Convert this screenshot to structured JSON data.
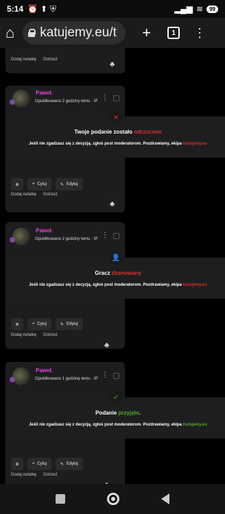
{
  "status": {
    "time": "5:14",
    "battery": "99"
  },
  "browser": {
    "url": "katujemy.eu/t",
    "tabs": "1"
  },
  "labels": {
    "add_note": "Dodaj notatkę",
    "warn": "Ostrzeż",
    "quote": "Cytuj",
    "edit": "Edytuj"
  },
  "posts": [
    {
      "author": "Paweł.",
      "published": "Opublikowano 2 godziny temu · IP",
      "notice_prefix": "Twoje podanie zostało ",
      "notice_status": "odrzucone",
      "notice_body": "Jeśli nie zgadzasz się z decyzją, zgłoś post moderatorom. Pozdrawiamy, ekipa ",
      "notice_brand": "Katujemy.eu",
      "color": "#d9302c"
    },
    {
      "author": "Paweł.",
      "published": "Opublikowano 2 godziny temu · IP",
      "notice_prefix": "Gracz ",
      "notice_status": "zbanowany",
      "notice_body": "Jeśli nie zgadzasz się z decyzją, zgłoś post moderatorom. Pozdrawiamy, ekipa ",
      "notice_brand": "Katujemy.eu",
      "color": "#d9302c"
    },
    {
      "author": "Paweł.",
      "published": "Opublikowano 1 godzinę temu · IP",
      "notice_prefix": "Podanie ",
      "notice_status": "przyjęte",
      "notice_suffix": ".",
      "notice_body": "Jeśli nie zgadzasz się z decyzją, zgłoś post moderatorom. Pozdrawiamy, ekipa ",
      "notice_brand": "Katujemy.eu",
      "color": "#4caf2a"
    }
  ]
}
